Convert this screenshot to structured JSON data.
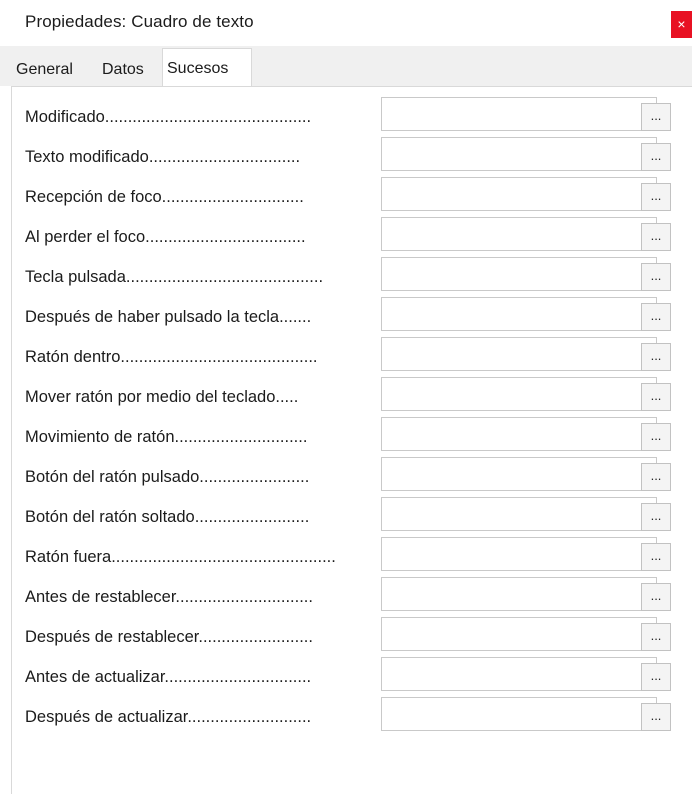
{
  "window": {
    "title": "Propiedades: Cuadro de texto",
    "close_glyph": "×"
  },
  "tabs": [
    {
      "label": "General",
      "active": false
    },
    {
      "label": "Datos",
      "active": false
    },
    {
      "label": "Sucesos",
      "active": true
    }
  ],
  "events": [
    {
      "label": "Modificado.............................................",
      "value": "",
      "button": "..."
    },
    {
      "label": "Texto modificado.................................",
      "value": "",
      "button": "..."
    },
    {
      "label": "Recepción de foco...............................",
      "value": "",
      "button": "..."
    },
    {
      "label": "Al perder el foco...................................",
      "value": "",
      "button": "..."
    },
    {
      "label": "Tecla pulsada...........................................",
      "value": "",
      "button": "..."
    },
    {
      "label": "Después de haber pulsado la tecla.......",
      "value": "",
      "button": "..."
    },
    {
      "label": "Ratón dentro...........................................",
      "value": "",
      "button": "..."
    },
    {
      "label": "Mover ratón por medio del teclado.....",
      "value": "",
      "button": "..."
    },
    {
      "label": "Movimiento de ratón.............................",
      "value": "",
      "button": "..."
    },
    {
      "label": "Botón del ratón pulsado........................",
      "value": "",
      "button": "..."
    },
    {
      "label": "Botón del ratón soltado.........................",
      "value": "",
      "button": "..."
    },
    {
      "label": "Ratón fuera.................................................",
      "value": "",
      "button": "..."
    },
    {
      "label": "Antes de restablecer..............................",
      "value": "",
      "button": "..."
    },
    {
      "label": "Después de restablecer.........................",
      "value": "",
      "button": "..."
    },
    {
      "label": "Antes de actualizar................................",
      "value": "",
      "button": "..."
    },
    {
      "label": "Después de actualizar...........................",
      "value": "",
      "button": "..."
    }
  ]
}
